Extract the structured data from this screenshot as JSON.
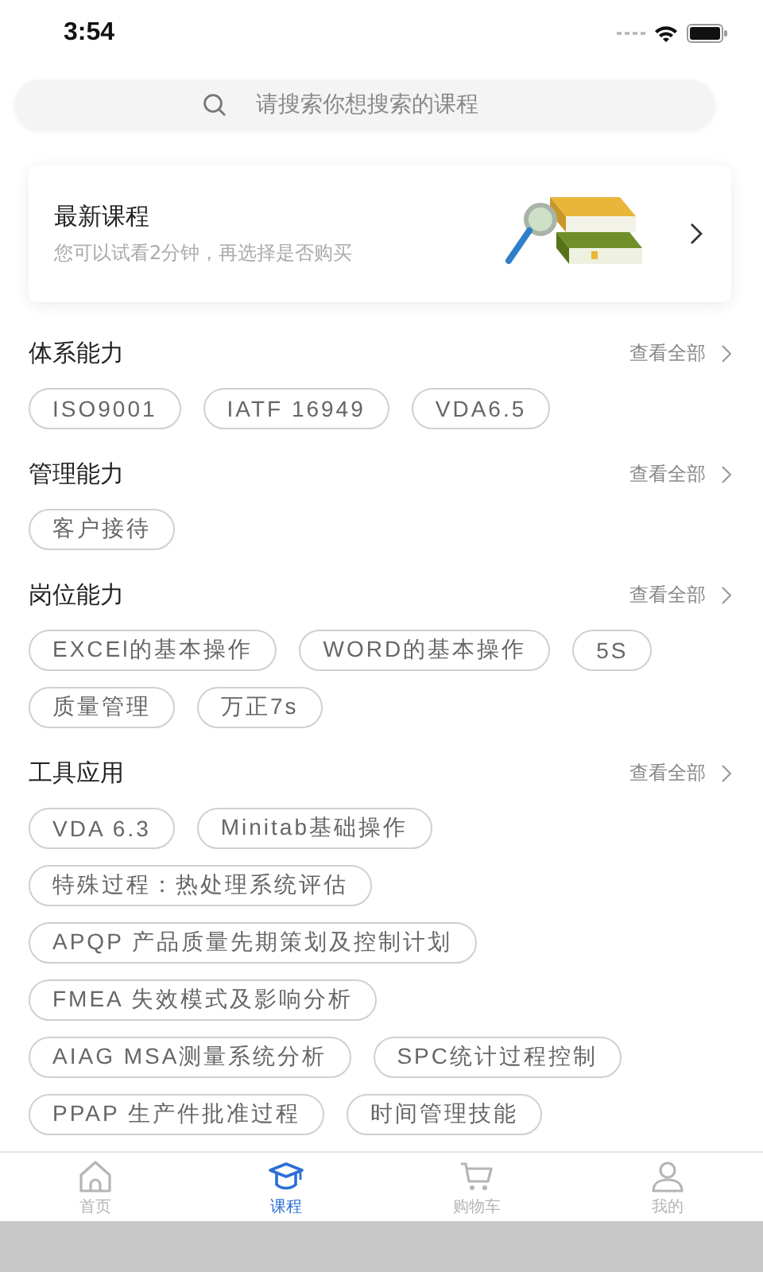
{
  "status_bar": {
    "time": "3:54"
  },
  "search": {
    "placeholder": "请搜索你想搜索的课程"
  },
  "banner": {
    "title": "最新课程",
    "subtitle": "您可以试看2分钟，再选择是否购买"
  },
  "sections": [
    {
      "title": "体系能力",
      "more": "查看全部",
      "tags": [
        "ISO9001",
        "IATF 16949",
        "VDA6.5"
      ]
    },
    {
      "title": "管理能力",
      "more": "查看全部",
      "tags": [
        "客户接待"
      ]
    },
    {
      "title": "岗位能力",
      "more": "查看全部",
      "tags": [
        "EXCEl的基本操作",
        "WORD的基本操作",
        "5S",
        "质量管理",
        "万正7s"
      ]
    },
    {
      "title": "工具应用",
      "more": "查看全部",
      "tags": [
        "VDA 6.3",
        "Minitab基础操作",
        "特殊过程：热处理系统评估",
        "APQP 产品质量先期策划及控制计划",
        "FMEA 失效模式及影响分析",
        "AIAG MSA测量系统分析",
        "SPC统计过程控制",
        "PPAP 生产件批准过程",
        "时间管理技能"
      ]
    }
  ],
  "tab_bar": [
    {
      "kind": "home",
      "label": "首页",
      "selected": false
    },
    {
      "kind": "course",
      "label": "课程",
      "selected": true
    },
    {
      "kind": "cart",
      "label": "购物车",
      "selected": false
    },
    {
      "kind": "profile",
      "label": "我的",
      "selected": false
    }
  ]
}
